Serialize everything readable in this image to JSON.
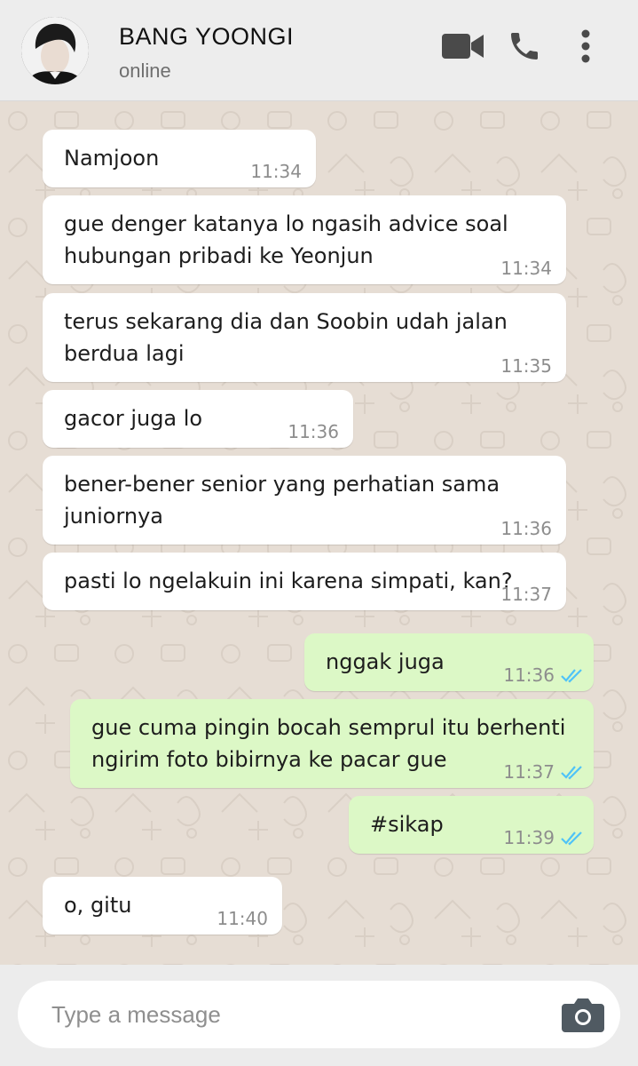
{
  "contact": {
    "name": "BANG YOONGI",
    "status": "online"
  },
  "header_icons": [
    "video-call-icon",
    "phone-icon",
    "more-options-icon"
  ],
  "colors": {
    "incoming_bubble": "#ffffff",
    "outgoing_bubble": "#dcf8c6",
    "read_ticks": "#4fc3f7",
    "header_bg": "#ededed"
  },
  "messages": [
    {
      "direction": "in",
      "text": "Namjoon",
      "time": "11:34"
    },
    {
      "direction": "in",
      "text": "gue denger katanya lo ngasih advice soal\nhubungan pribadi ke Yeonjun",
      "time": "11:34"
    },
    {
      "direction": "in",
      "text": "terus sekarang dia dan Soobin udah jalan\nberdua lagi",
      "time": "11:35"
    },
    {
      "direction": "in",
      "text": "gacor juga lo",
      "time": "11:36"
    },
    {
      "direction": "in",
      "text": "bener-bener senior yang perhatian sama\njuniornya",
      "time": "11:36"
    },
    {
      "direction": "in",
      "text": "pasti lo ngelakuin ini karena simpati, kan?",
      "time": "11:37"
    },
    {
      "direction": "out",
      "text": "nggak juga",
      "time": "11:36",
      "status": "read"
    },
    {
      "direction": "out",
      "text": "gue cuma pingin bocah semprul itu berhenti\nngirim foto bibirnya ke pacar gue",
      "time": "11:37",
      "status": "read"
    },
    {
      "direction": "out",
      "text": "#sikap",
      "time": "11:39",
      "status": "read"
    },
    {
      "direction": "in",
      "text": "o, gitu",
      "time": "11:40"
    }
  ],
  "composer": {
    "placeholder": "Type a message",
    "camera_icon": "camera-icon"
  }
}
